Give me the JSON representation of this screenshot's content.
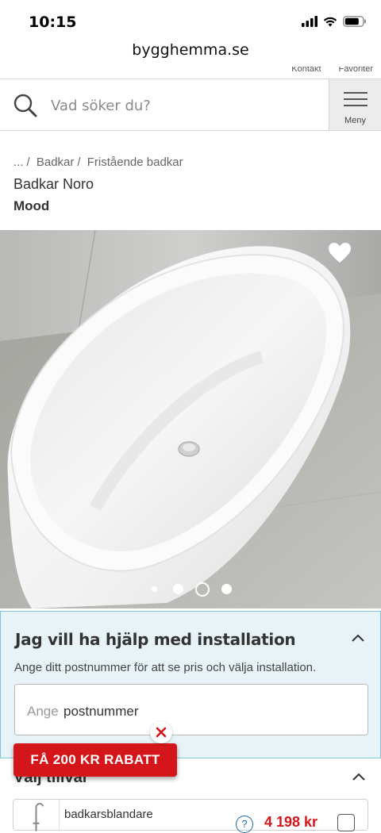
{
  "status_bar": {
    "time": "10:15"
  },
  "browser": {
    "url": "bygghemma.se"
  },
  "top_links": {
    "contact": "Kontakt",
    "favorites": "Favoriter"
  },
  "search": {
    "placeholder": "Vad söker du?"
  },
  "menu": {
    "label": "Meny"
  },
  "breadcrumb": {
    "ellipsis": "...",
    "separator": "/",
    "level1": "Badkar",
    "level2": "Fristående badkar"
  },
  "product": {
    "title": "Badkar Noro",
    "brand": "Mood"
  },
  "gallery": {
    "image_count": 4,
    "active_index": 2
  },
  "installation": {
    "title": "Jag vill ha hjälp med installation",
    "description": "Ange ditt postnummer för att se pris och välja installation.",
    "field_placeholder": "Ange",
    "field_value": "postnummer"
  },
  "options": {
    "title": "Välj tillval",
    "items": [
      {
        "name": "badkarsblandare",
        "info": "?",
        "price": "4 198 kr"
      }
    ]
  },
  "promo": {
    "label": "FÅ 200 KR RABATT"
  },
  "colors": {
    "promo_red": "#d4161b",
    "install_bg": "#e8f3f7",
    "install_border": "#7fc6de",
    "link_blue": "#1b6aa5"
  }
}
